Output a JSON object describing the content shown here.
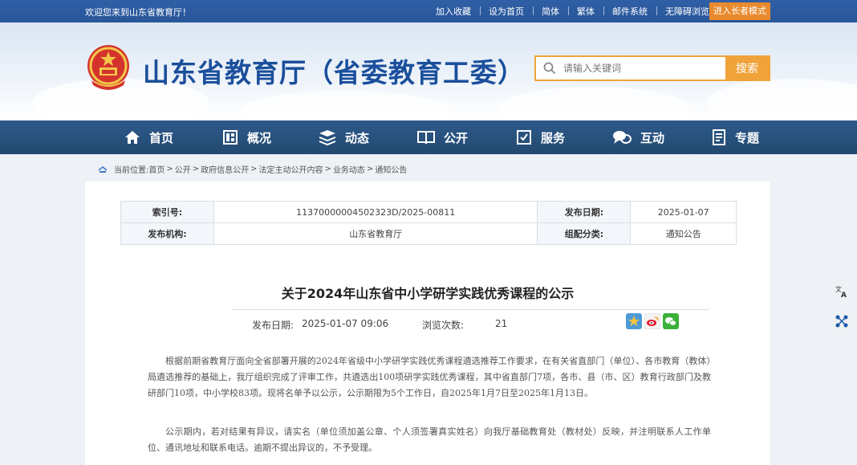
{
  "topbar": {
    "welcome": "欢迎您来到山东省教育厅！",
    "links": [
      "加入收藏",
      "设为首页",
      "简体",
      "繁体",
      "邮件系统",
      "无障碍浏览"
    ],
    "elder_mode": "进入长者模式"
  },
  "header": {
    "site_title": "山东省教育厅（省委教育工委）",
    "search_placeholder": "请输入关键词",
    "search_button": "搜索"
  },
  "nav": {
    "items": [
      {
        "label": "首页",
        "icon": "home-icon"
      },
      {
        "label": "概况",
        "icon": "overview-icon"
      },
      {
        "label": "动态",
        "icon": "news-icon"
      },
      {
        "label": "公开",
        "icon": "open-book-icon"
      },
      {
        "label": "服务",
        "icon": "service-icon"
      },
      {
        "label": "互动",
        "icon": "chat-icon"
      },
      {
        "label": "专题",
        "icon": "topic-icon"
      }
    ]
  },
  "breadcrumb": {
    "prefix": "当前位置:",
    "items": [
      "首页",
      "公开",
      "政府信息公开",
      "法定主动公开内容",
      "业务动态",
      "通知公告"
    ]
  },
  "meta_table": {
    "index_label": "索引号:",
    "index_value": "11370000004502323D/2025-00811",
    "date_label": "发布日期:",
    "date_value": "2025-01-07",
    "publisher_label": "发布机构:",
    "publisher_value": "山东省教育厅",
    "category_label": "组配分类:",
    "category_value": "通知公告"
  },
  "article": {
    "title": "关于2024年山东省中小学研学实践优秀课程的公示",
    "publish_label": "发布日期:",
    "publish_value": "2025-01-07 09:06",
    "views_label": "浏览次数:",
    "views_value": "21",
    "paragraphs": [
      "根据前期省教育厅面向全省部署开展的2024年省级中小学研学实践优秀课程遴选推荐工作要求，在有关省直部门（单位）、各市教育（教体）局遴选推荐的基础上，我厅组织完成了评审工作，共遴选出100项研学实践优秀课程，其中省直部门7项，各市、县（市、区）教育行政部门及教研部门10项，中小学校83项。现将名单予以公示，公示期限为5个工作日，自2025年1月7日至2025年1月13日。",
      "公示期内，若对结果有异议，请实名（单位须加盖公章、个人须签署真实姓名）向我厅基础教育处（教材处）反映，并注明联系人工作单位、通讯地址和联系电话。逾期不提出异议的，不予受理。"
    ]
  },
  "colors": {
    "primary_blue": "#1b4f9c",
    "nav_blue": "#25507f",
    "accent_orange": "#f0a33a"
  }
}
